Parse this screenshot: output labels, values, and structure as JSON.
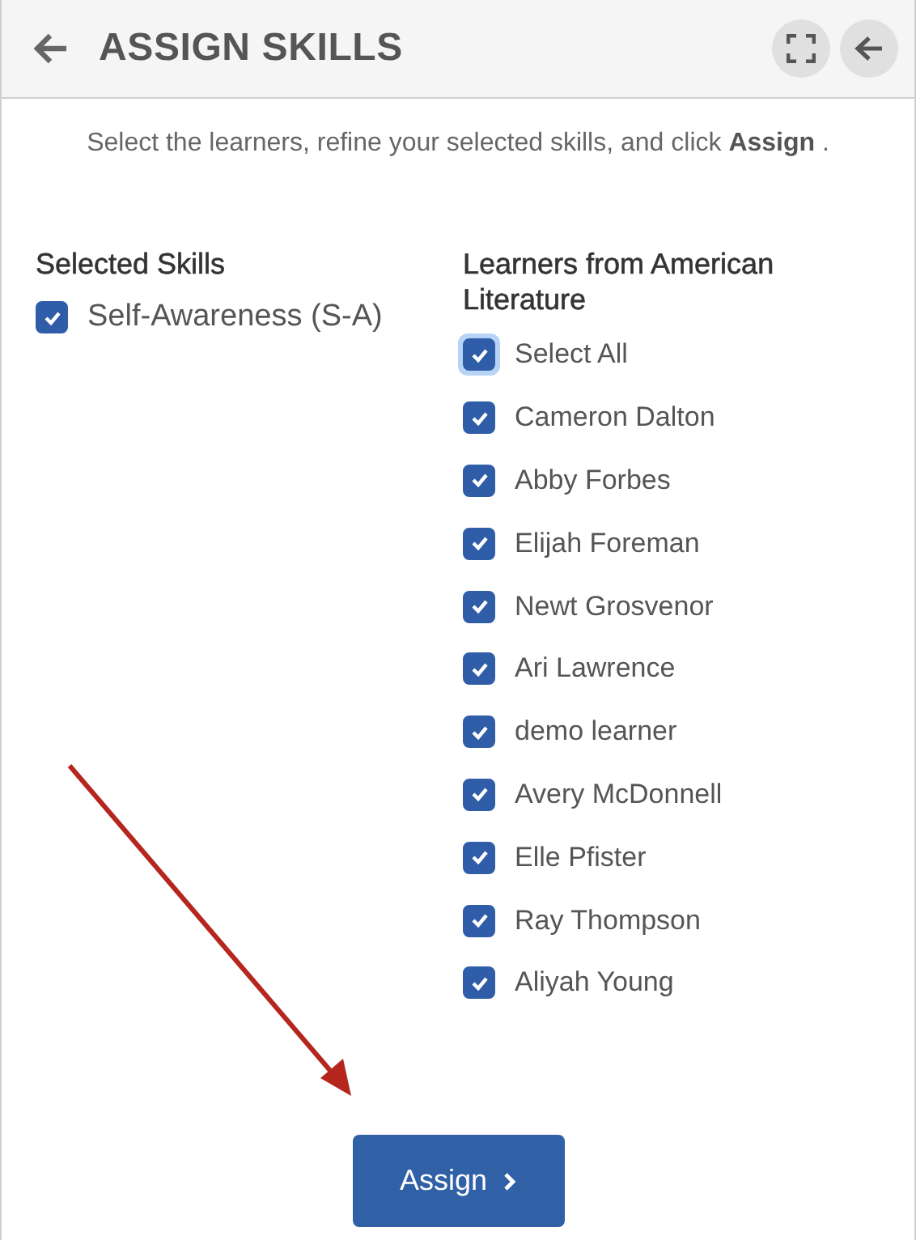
{
  "header": {
    "title": "ASSIGN SKILLS"
  },
  "instruction": "Select the learners, refine your selected skills, and click **Assign** .",
  "skills": {
    "heading": "Selected Skills",
    "items": [
      {
        "label": "Self-Awareness (S-A)",
        "checked": true
      }
    ]
  },
  "learners": {
    "heading": "Learners from American Literature",
    "items": [
      {
        "label": "Select All",
        "checked": true,
        "focused": true
      },
      {
        "label": "Cameron Dalton",
        "checked": true,
        "focused": false
      },
      {
        "label": "Abby Forbes",
        "checked": true,
        "focused": false
      },
      {
        "label": "Elijah Foreman",
        "checked": true,
        "focused": false
      },
      {
        "label": "Newt Grosvenor",
        "checked": true,
        "focused": false
      },
      {
        "label": "Ari Lawrence",
        "checked": true,
        "focused": false
      },
      {
        "label": "demo learner",
        "checked": true,
        "focused": false
      },
      {
        "label": "Avery McDonnell",
        "checked": true,
        "focused": false
      },
      {
        "label": "Elle Pfister",
        "checked": true,
        "focused": false
      },
      {
        "label": "Ray Thompson",
        "checked": true,
        "focused": false
      },
      {
        "label": "Aliyah Young",
        "checked": true,
        "focused": false
      }
    ]
  },
  "assign_button": {
    "label": "Assign"
  }
}
